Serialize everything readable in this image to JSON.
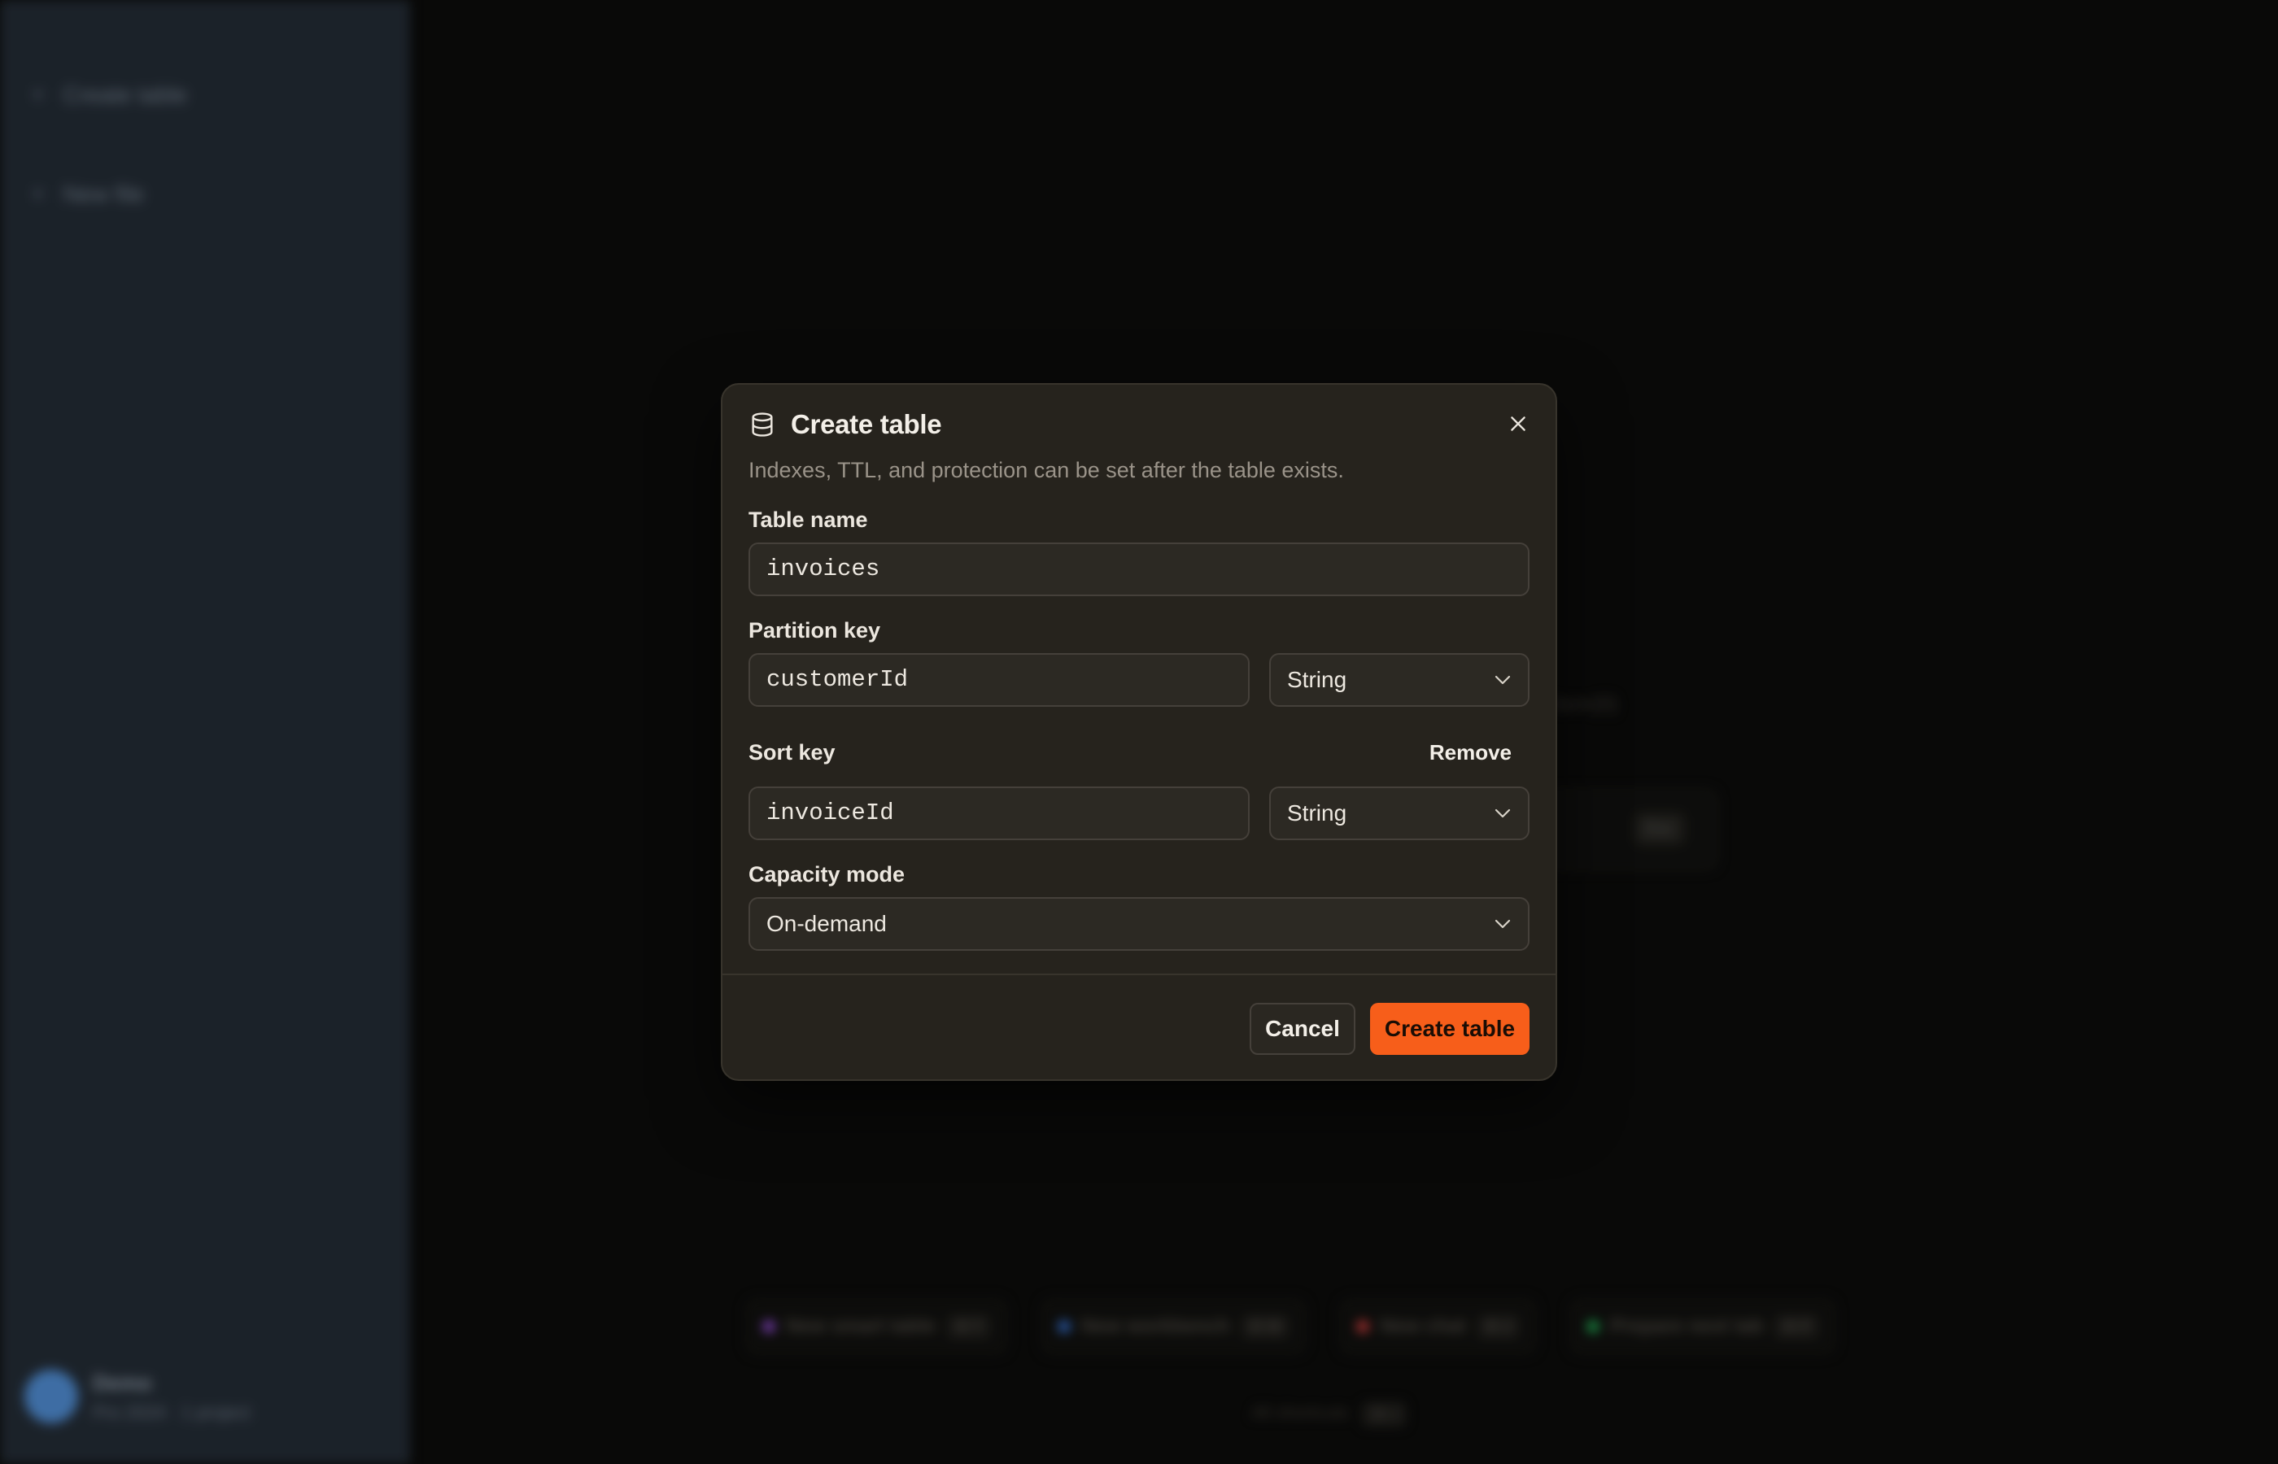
{
  "background": {
    "sidebar": {
      "items": [
        {
          "label": "Create table"
        },
        {
          "label": "New file"
        }
      ],
      "user": {
        "name": "Demo",
        "sub": "Pro 2024 · 1 project"
      }
    },
    "ghost_text": "Item(0)",
    "ghost_chip": "Esc",
    "chips": [
      {
        "label": "New smart table",
        "kbd": "⌘ T",
        "color": "#a855f7"
      },
      {
        "label": "New workbench",
        "kbd": "⌘ W",
        "color": "#3b82f6"
      },
      {
        "label": "New chat",
        "kbd": "⌘ J",
        "color": "#ef4444"
      },
      {
        "label": "Prepare next tab",
        "kbd": "⌘ P",
        "color": "#22c55e"
      }
    ],
    "footnote": {
      "text": "All shortcuts",
      "kbd": "⌘ /"
    }
  },
  "modal": {
    "icon": "database-icon",
    "title": "Create table",
    "subtitle": "Indexes, TTL, and protection can be set after the table exists.",
    "close_icon": "close-icon",
    "table_name": {
      "label": "Table name",
      "value": "invoices"
    },
    "partition_key": {
      "label": "Partition key",
      "value": "customerId",
      "type": "String"
    },
    "sort_key": {
      "label": "Sort key",
      "value": "invoiceId",
      "type": "String",
      "remove_label": "Remove"
    },
    "capacity_mode": {
      "label": "Capacity mode",
      "value": "On-demand"
    },
    "cancel_label": "Cancel",
    "submit_label": "Create table",
    "accent_color": "#f75e1a"
  }
}
